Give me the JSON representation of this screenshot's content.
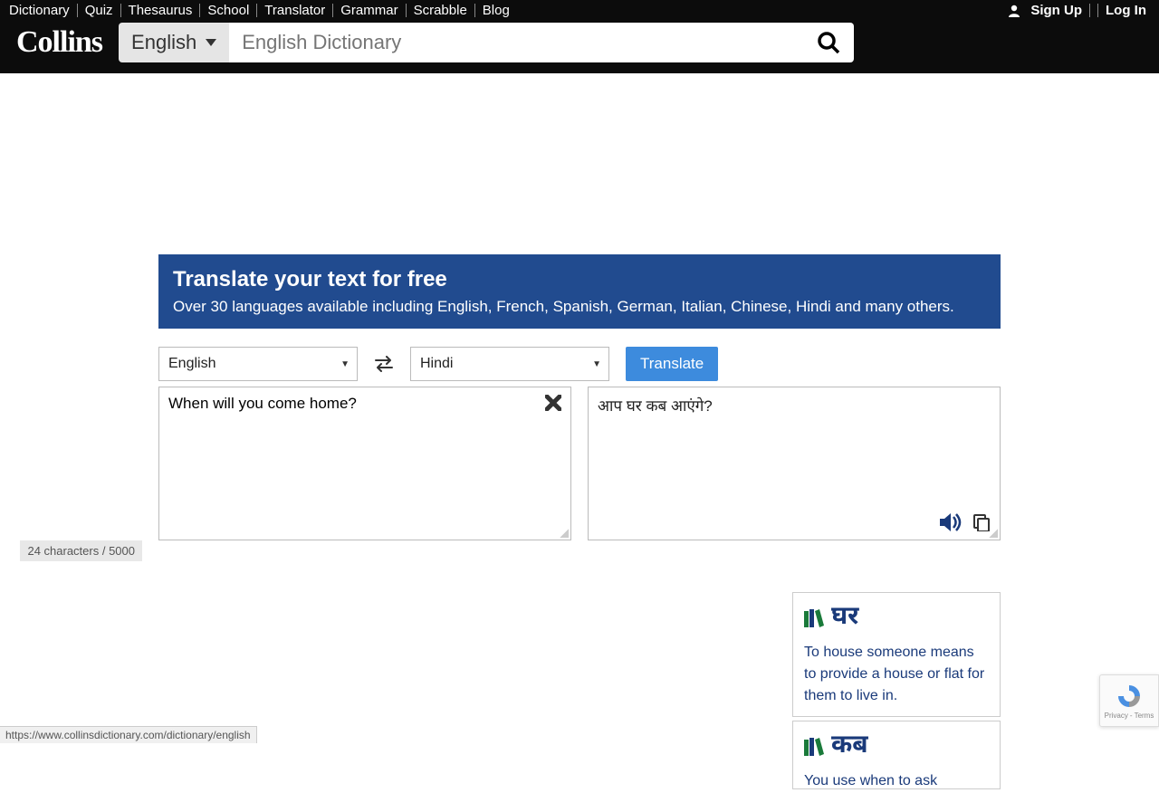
{
  "nav": {
    "items": [
      "Dictionary",
      "Quiz",
      "Thesaurus",
      "School",
      "Translator",
      "Grammar",
      "Scrabble",
      "Blog"
    ]
  },
  "auth": {
    "signup": "Sign Up",
    "login": "Log In"
  },
  "logo": "Collins",
  "lang_selector": "English",
  "search": {
    "placeholder": "English Dictionary"
  },
  "banner": {
    "title": "Translate your text for free",
    "subtitle": "Over 30 languages available including English, French, Spanish, German, Italian, Chinese, Hindi and many others."
  },
  "translator": {
    "from_lang": "English",
    "to_lang": "Hindi",
    "button": "Translate",
    "input_text": "When will you come home?",
    "output_text": "आप घर कब आएंगे?",
    "char_count": "24 characters / 5000"
  },
  "definitions": [
    {
      "word": "घर",
      "text": "To house someone means to provide a house or flat for them to live in."
    },
    {
      "word": "कब",
      "text": "You use when to ask"
    }
  ],
  "status_url": "https://www.collinsdictionary.com/dictionary/english",
  "recaptcha": {
    "privacy": "Privacy",
    "terms": "Terms"
  }
}
